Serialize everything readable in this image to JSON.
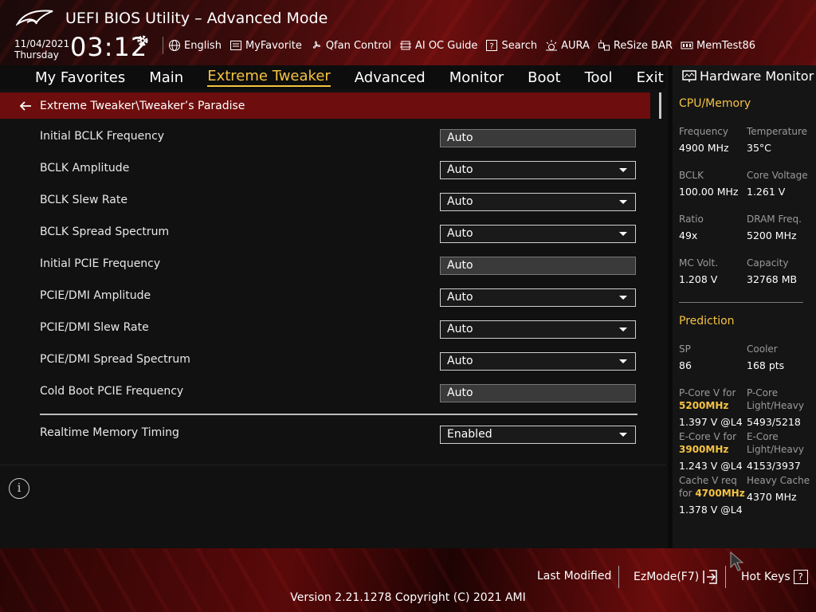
{
  "header": {
    "title": "UEFI BIOS Utility – Advanced Mode",
    "date": "11/04/2021",
    "day": "Thursday",
    "time": "03:12",
    "toolbar": [
      {
        "label": "English",
        "icon": "globe-icon"
      },
      {
        "label": "MyFavorite",
        "icon": "favorite-list-icon"
      },
      {
        "label": "Qfan Control",
        "icon": "fan-icon"
      },
      {
        "label": "AI OC Guide",
        "icon": "ai-chip-icon"
      },
      {
        "label": "Search",
        "icon": "search-icon"
      },
      {
        "label": "AURA",
        "icon": "aura-light-icon"
      },
      {
        "label": "ReSize BAR",
        "icon": "resize-bar-icon"
      },
      {
        "label": "MemTest86",
        "icon": "memory-icon"
      }
    ]
  },
  "nav": {
    "tabs": [
      "My Favorites",
      "Main",
      "Extreme Tweaker",
      "Advanced",
      "Monitor",
      "Boot",
      "Tool",
      "Exit"
    ],
    "active": "Extreme Tweaker"
  },
  "breadcrumb": "Extreme Tweaker\\Tweaker’s Paradise",
  "settings": [
    {
      "label": "Initial BCLK Frequency",
      "value": "Auto",
      "type": "input"
    },
    {
      "label": "BCLK Amplitude",
      "value": "Auto",
      "type": "dropdown"
    },
    {
      "label": "BCLK Slew Rate",
      "value": "Auto",
      "type": "dropdown"
    },
    {
      "label": "BCLK Spread Spectrum",
      "value": "Auto",
      "type": "dropdown"
    },
    {
      "label": "Initial PCIE Frequency",
      "value": "Auto",
      "type": "input"
    },
    {
      "label": "PCIE/DMI Amplitude",
      "value": "Auto",
      "type": "dropdown"
    },
    {
      "label": "PCIE/DMI Slew Rate",
      "value": "Auto",
      "type": "dropdown"
    },
    {
      "label": "PCIE/DMI Spread Spectrum",
      "value": "Auto",
      "type": "dropdown"
    },
    {
      "label": "Cold Boot PCIE Frequency",
      "value": "Auto",
      "type": "input"
    },
    {
      "label": "Realtime Memory Timing",
      "value": "Enabled",
      "type": "dropdown"
    }
  ],
  "hardware_monitor": {
    "title": "Hardware Monitor",
    "cpu_section": "CPU/Memory",
    "cpu": [
      {
        "l": "Frequency",
        "v": "4900 MHz"
      },
      {
        "l": "Temperature",
        "v": "35°C"
      },
      {
        "l": "BCLK",
        "v": "100.00 MHz"
      },
      {
        "l": "Core Voltage",
        "v": "1.261 V"
      },
      {
        "l": "Ratio",
        "v": "49x"
      },
      {
        "l": "DRAM Freq.",
        "v": "5200 MHz"
      },
      {
        "l": "MC Volt.",
        "v": "1.208 V"
      },
      {
        "l": "Capacity",
        "v": "32768 MB"
      }
    ],
    "prediction_section": "Prediction",
    "sp_label": "SP",
    "sp_value": "86",
    "cooler_label": "Cooler",
    "cooler_value": "168 pts",
    "pcore_label": "P-Core V for",
    "pcore_freq": "5200MHz",
    "pcore_value": "1.397 V @L4",
    "pcore_lh_label1": "P-Core",
    "pcore_lh_label2": "Light/Heavy",
    "pcore_lh_value": "5493/5218",
    "ecore_label": "E-Core V for",
    "ecore_freq": "3900MHz",
    "ecore_value": "1.243 V @L4",
    "ecore_lh_label1": "E-Core",
    "ecore_lh_label2": "Light/Heavy",
    "ecore_lh_value": "4153/3937",
    "cache_label1": "Cache V req",
    "cache_label2": "for",
    "cache_freq": "4700MHz",
    "cache_value": "1.378 V @L4",
    "heavy_cache_label": "Heavy Cache",
    "heavy_cache_value": "4370 MHz"
  },
  "footer": {
    "last_modified": "Last Modified",
    "ezmode": "EzMode(F7)",
    "hotkeys": "Hot Keys",
    "hotkeys_key": "?",
    "version": "Version 2.21.1278 Copyright (C) 2021 AMI"
  },
  "colors": {
    "accent": "#f5c242",
    "brand_red": "#6e0d0d"
  }
}
